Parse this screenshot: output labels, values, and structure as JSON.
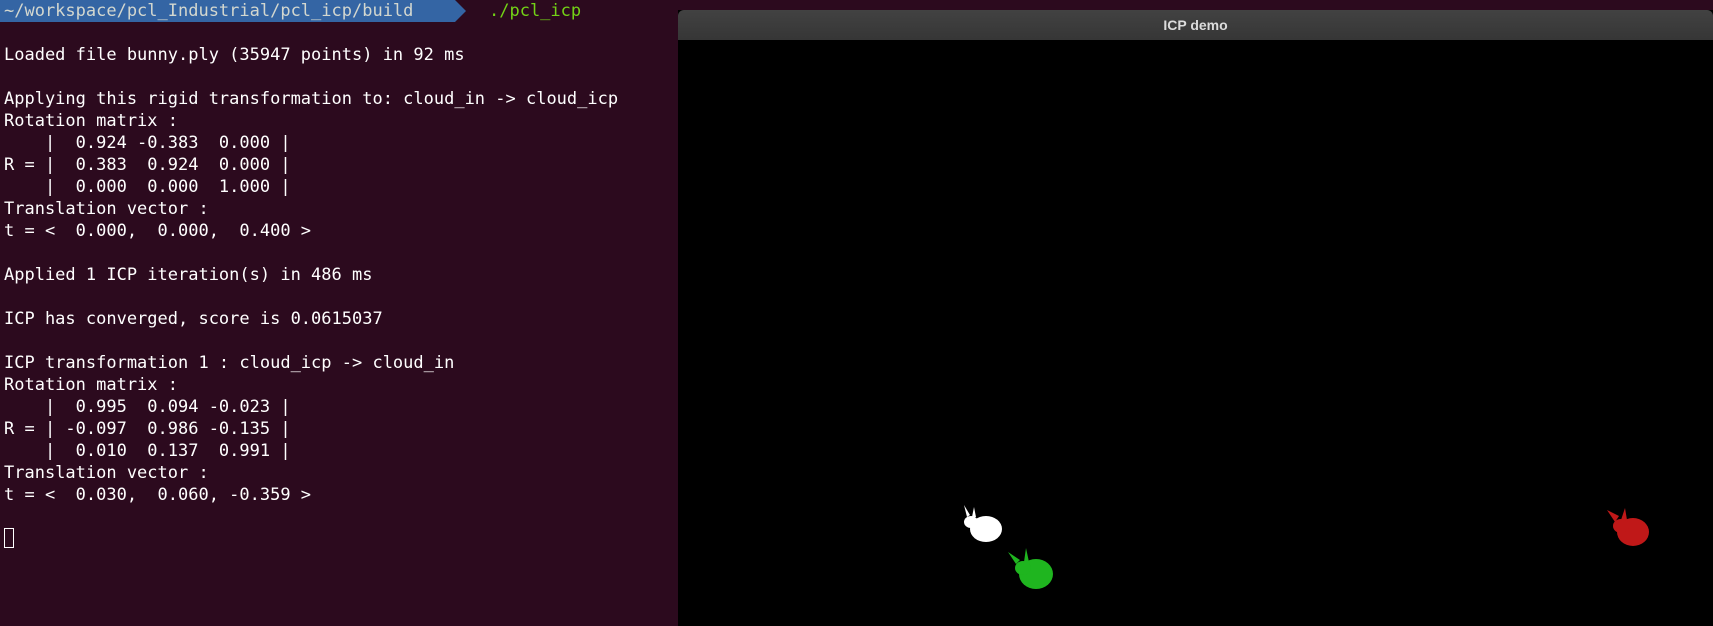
{
  "terminal": {
    "prompt_path": "~/workspace/pcl_Industrial/pcl_icp/build",
    "prompt_command": "./pcl_icp",
    "lines": [
      "Loaded file bunny.ply (35947 points) in 92 ms",
      "",
      "Applying this rigid transformation to: cloud_in -> cloud_icp",
      "Rotation matrix :",
      "    |  0.924 -0.383  0.000 |",
      "R = |  0.383  0.924  0.000 |",
      "    |  0.000  0.000  1.000 |",
      "Translation vector :",
      "t = <  0.000,  0.000,  0.400 >",
      "",
      "Applied 1 ICP iteration(s) in 486 ms",
      "",
      "ICP has converged, score is 0.0615037",
      "",
      "ICP transformation 1 : cloud_icp -> cloud_in",
      "Rotation matrix :",
      "    |  0.995  0.094 -0.023 |",
      "R = | -0.097  0.986 -0.135 |",
      "    |  0.010  0.137  0.991 |",
      "Translation vector :",
      "t = <  0.030,  0.060, -0.359 >"
    ]
  },
  "viewer": {
    "title": "ICP demo",
    "clouds": [
      {
        "name": "white-cloud",
        "color": "#ffffff"
      },
      {
        "name": "green-cloud",
        "color": "#1fb51f"
      },
      {
        "name": "red-cloud",
        "color": "#c01818"
      }
    ]
  },
  "colors": {
    "terminal_bg": "#2c0a1e",
    "prompt_bg": "#3465a4",
    "prompt_cmd": "#73d216",
    "viewer_bg": "#000000"
  }
}
